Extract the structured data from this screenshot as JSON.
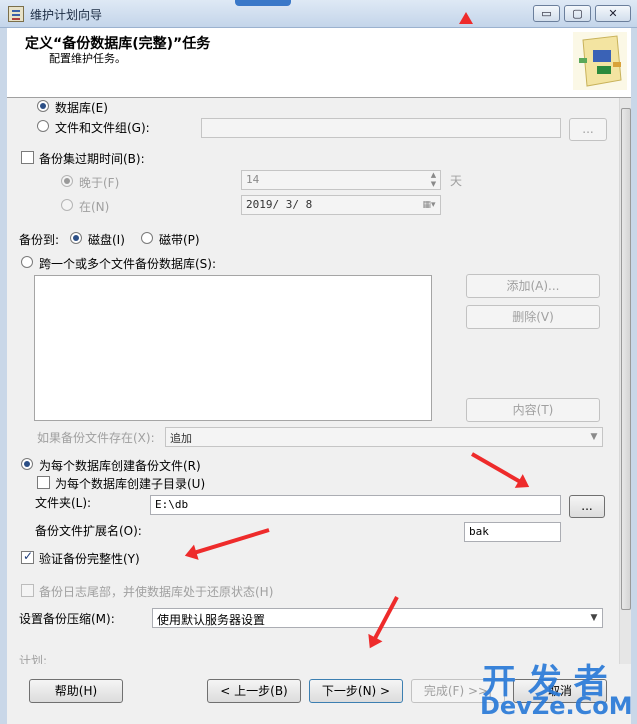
{
  "window": {
    "title": "维护计划向导",
    "buttons": {
      "minimize": "▭",
      "maximize": "▢",
      "close": "✕"
    }
  },
  "header": {
    "title": "定义“备份数据库(完整)”任务",
    "subtitle": "配置维护任务。"
  },
  "backup_component": {
    "database_label": "数据库(E)",
    "files_label": "文件和文件组(G):",
    "files_browse": "..."
  },
  "expire": {
    "label": "备份集过期时间(B):",
    "after_label": "晚于(F)",
    "after_value": "14",
    "after_unit": "天",
    "on_label": "在(N)",
    "on_value": "2019/ 3/ 8"
  },
  "backup_to": {
    "label": "备份到:",
    "disk": "磁盘(I)",
    "tape": "磁带(P)"
  },
  "span": {
    "label": "跨一个或多个文件备份数据库(S):",
    "add": "添加(A)...",
    "remove": "删除(V)",
    "contents": "内容(T)",
    "exists_label": "如果备份文件存在(X):",
    "exists_value": "追加"
  },
  "per_db": {
    "label": "为每个数据库创建备份文件(R)",
    "subdir_label": "为每个数据库创建子目录(U)",
    "folder_label": "文件夹(L):",
    "folder_value": "E:\\db",
    "folder_browse": "...",
    "ext_label": "备份文件扩展名(O):",
    "ext_value": "bak"
  },
  "verify": {
    "label": "验证备份完整性(Y)"
  },
  "tail_log": {
    "label": "备份日志尾部，并使数据库处于还原状态(H)"
  },
  "compression": {
    "label": "设置备份压缩(M):",
    "value": "使用默认服务器设置"
  },
  "schedule": {
    "label": "计划:"
  },
  "footer": {
    "help": "帮助(H)",
    "back": "< 上一步(B)",
    "next": "下一步(N) >",
    "finish": "完成(F) >>|",
    "cancel": "取消"
  },
  "watermark": {
    "line1": "开 发 者",
    "line2": "DevZe.CoM"
  },
  "colors": {
    "annotation_arrow": "#ee2b2b",
    "window_frame": "#c9d7e8",
    "content_bg": "#f0f0f0"
  }
}
